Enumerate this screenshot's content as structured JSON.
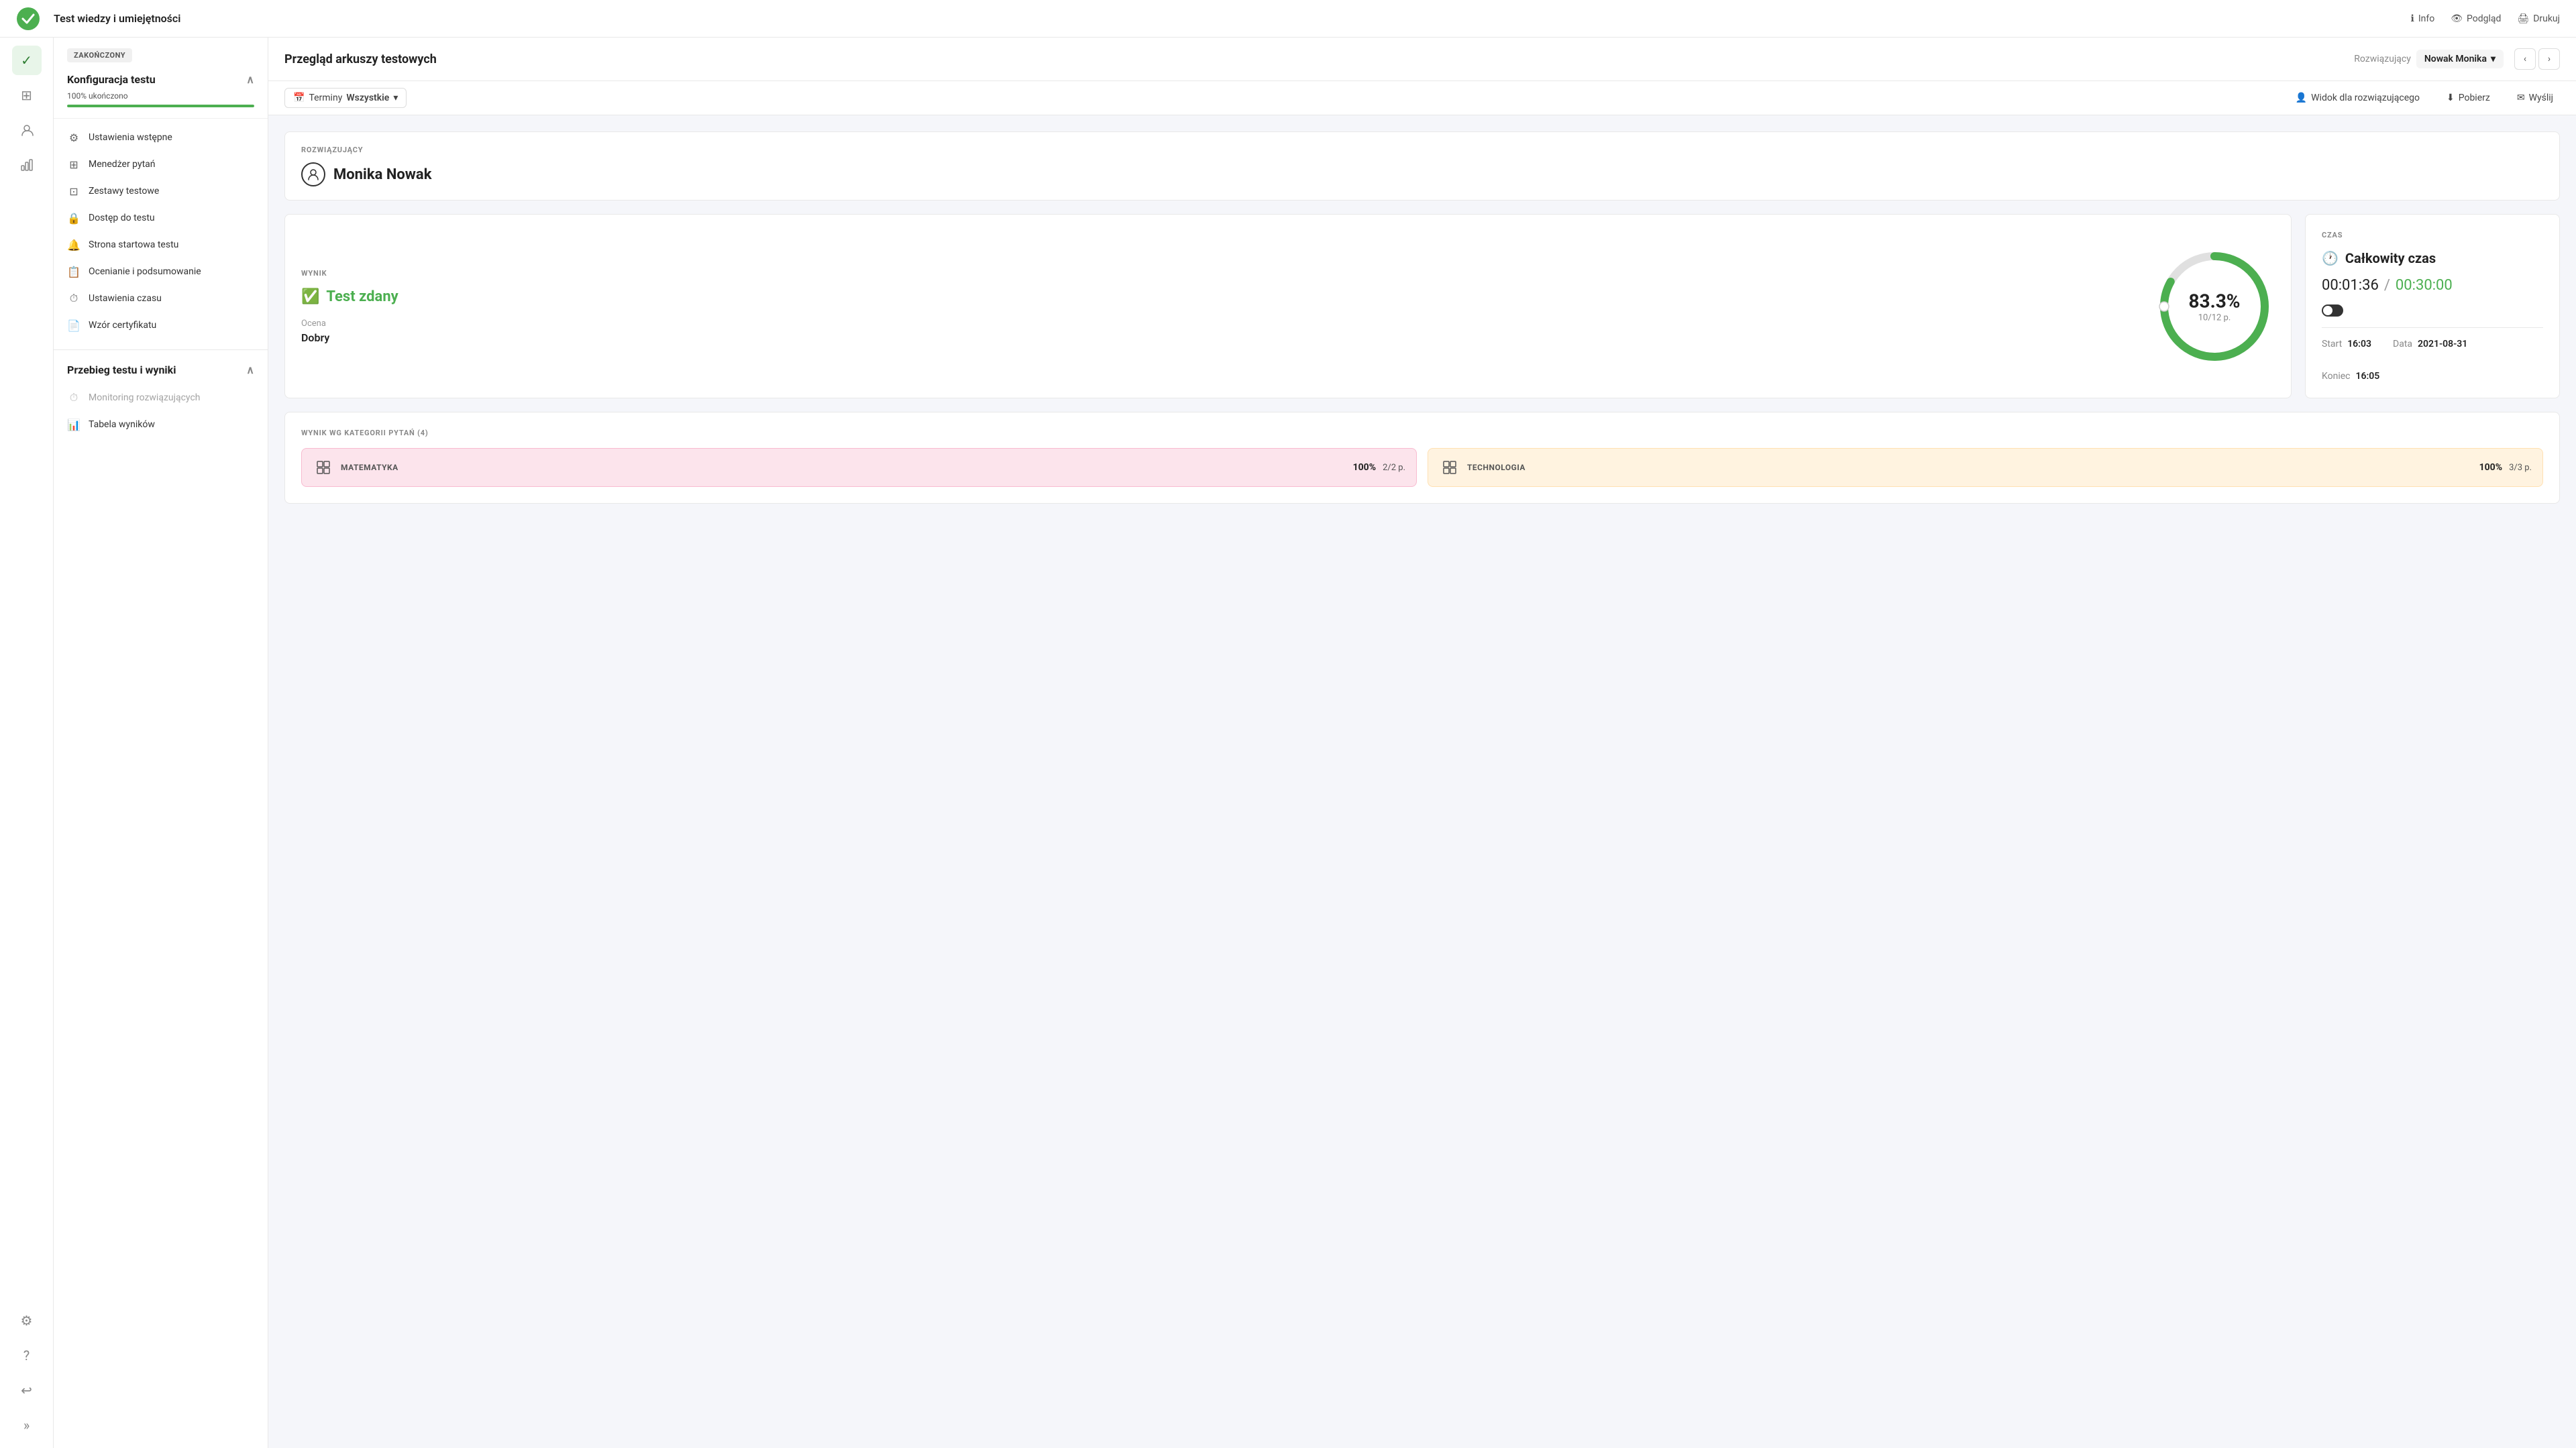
{
  "header": {
    "title": "Test wiedzy i umiejętności",
    "actions": [
      {
        "label": "Info",
        "icon": "ℹ"
      },
      {
        "label": "Podgląd",
        "icon": "👁"
      },
      {
        "label": "Drukuj",
        "icon": "🖨"
      }
    ]
  },
  "sidebar": {
    "icons": [
      {
        "name": "check-icon",
        "symbol": "✓",
        "active": true
      },
      {
        "name": "grid-icon",
        "symbol": "⊞",
        "active": false
      },
      {
        "name": "users-icon",
        "symbol": "👤",
        "active": false
      },
      {
        "name": "chart-icon",
        "symbol": "📊",
        "active": false
      },
      {
        "name": "settings-icon",
        "symbol": "⚙",
        "active": false
      }
    ],
    "bottom_icons": [
      {
        "name": "question-icon",
        "symbol": "?"
      },
      {
        "name": "back-icon",
        "symbol": "↩"
      },
      {
        "name": "expand-icon",
        "symbol": "»"
      }
    ]
  },
  "left_panel": {
    "status_badge": "ZAKOŃCZONY",
    "section1": {
      "title": "Konfiguracja testu",
      "progress_label": "100% ukończono",
      "progress_pct": 100,
      "items": [
        {
          "label": "Ustawienia wstępne",
          "icon": "⚙"
        },
        {
          "label": "Menedżer pytań",
          "icon": "⊞"
        },
        {
          "label": "Zestawy testowe",
          "icon": "⊡"
        },
        {
          "label": "Dostęp do testu",
          "icon": "🔒"
        },
        {
          "label": "Strona startowa testu",
          "icon": "🔔"
        },
        {
          "label": "Ocenianie i podsumowanie",
          "icon": "📋"
        },
        {
          "label": "Ustawienia czasu",
          "icon": "⏱"
        },
        {
          "label": "Wzór certyfikatu",
          "icon": "📄"
        }
      ]
    },
    "section2": {
      "title": "Przebieg testu i wyniki",
      "items": [
        {
          "label": "Monitoring rozwiązujących",
          "icon": "⏱",
          "disabled": true
        },
        {
          "label": "Tabela wyników",
          "icon": "📊"
        }
      ]
    }
  },
  "content_header": {
    "title": "Przegląd arkuszy testowych",
    "solver_label": "Rozwiązujący",
    "solver_name": "Nowak Monika"
  },
  "toolbar": {
    "terminy_label": "Terminy",
    "terminy_value": "Wszystkie",
    "widok_label": "Widok dla rozwiązującego",
    "pobierz_label": "Pobierz",
    "wyslij_label": "Wyślij"
  },
  "solver_section": {
    "label": "ROZWIĄZUJĄCY",
    "name": "Monika Nowak"
  },
  "wynik_card": {
    "label": "WYNIK",
    "passed_text": "Test zdany",
    "ocena_label": "Ocena",
    "ocena_value": "Dobry",
    "percent": "83.3%",
    "points": "10/12 p."
  },
  "czas_card": {
    "label": "CZAS",
    "title": "Całkowity czas",
    "time_used": "00:01:36",
    "time_slash": "/",
    "time_total": "00:30:00",
    "start_label": "Start",
    "start_value": "16:03",
    "data_label": "Data",
    "data_value": "2021-08-31",
    "koniec_label": "Koniec",
    "koniec_value": "16:05"
  },
  "categories": {
    "label": "WYNIK WG KATEGORII PYTAŃ (4)",
    "items": [
      {
        "name": "MATEMATYKA",
        "pct": "100%",
        "pts": "2/2 p.",
        "color": "pink"
      },
      {
        "name": "TECHNOLOGIA",
        "pct": "100%",
        "pts": "3/3 p.",
        "color": "orange"
      }
    ]
  },
  "colors": {
    "green": "#4caf50",
    "light_green": "#e8f5e9",
    "pink_bg": "#fce4ec",
    "orange_bg": "#fff3e0"
  }
}
